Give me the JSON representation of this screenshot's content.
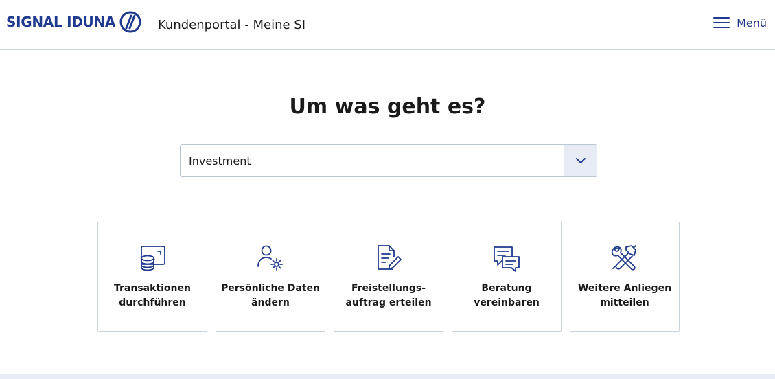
{
  "header": {
    "logo_text": "SIGNAL IDUNA",
    "portal_title": "Kundenportal - Meine SI",
    "menu_label": "Menü",
    "brand_color": "#1f3a8f"
  },
  "main": {
    "headline": "Um was geht es?",
    "topic_select": {
      "value": "Investment",
      "icon": "chevron-down-icon"
    },
    "tiles": [
      {
        "label": "Transaktionen\ndurchführen",
        "icon": "coins-transfer-icon"
      },
      {
        "label": "Persönliche Daten\nändern",
        "icon": "user-settings-icon"
      },
      {
        "label": "Freistellungs-\nauftrag erteilen",
        "icon": "document-edit-icon"
      },
      {
        "label": "Beratung\nvereinbaren",
        "icon": "chat-bubble-icon"
      },
      {
        "label": "Weitere Anliegen\nmitteilen",
        "icon": "tools-icon"
      }
    ]
  }
}
